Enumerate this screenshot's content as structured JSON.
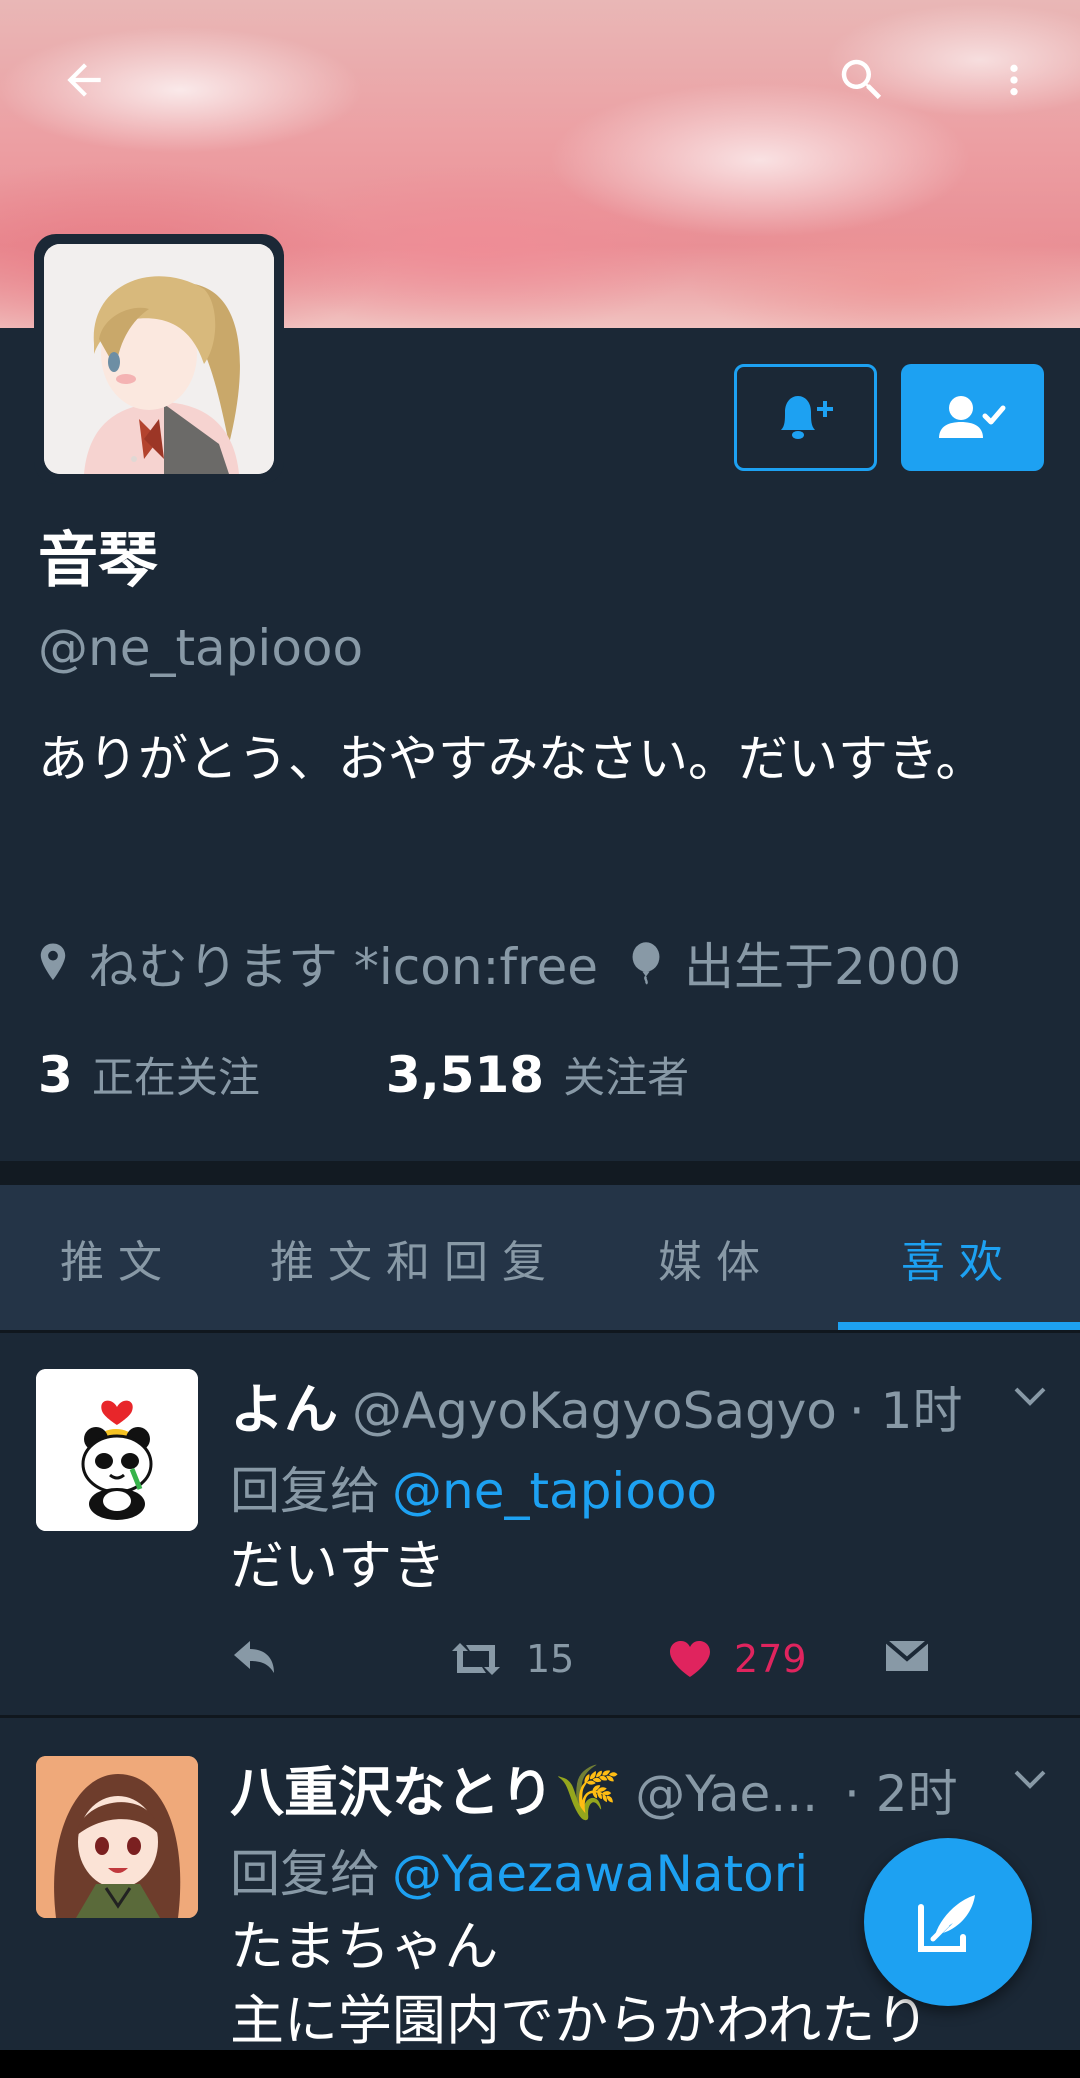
{
  "header": {
    "back_icon": "arrow-left-icon",
    "search_icon": "search-icon",
    "more_icon": "more-vertical-icon"
  },
  "profile": {
    "name": "音琴",
    "handle": "@ne_tapiooo",
    "bio": "ありがとう、おやすみなさい。だいすき。",
    "location": "ねむります *icon:free",
    "birth": "出生于2000",
    "following_count": "3",
    "following_label": "正在关注",
    "followers_count": "3,518",
    "followers_label": "关注者"
  },
  "buttons": {
    "notify_icon": "bell-plus-icon",
    "following_icon": "user-check-icon"
  },
  "tabs": [
    {
      "label": "推文",
      "active": false
    },
    {
      "label": "推文和回复",
      "active": false
    },
    {
      "label": "媒体",
      "active": false
    },
    {
      "label": "喜欢",
      "active": true
    }
  ],
  "tweets": [
    {
      "name": "よん",
      "handle": "@AgyoKagyoSagyo",
      "time": "· 1时",
      "reply_prefix": "回复给",
      "reply_to": "@ne_tapiooo",
      "text": "だいすき",
      "retweets": "15",
      "likes": "279",
      "liked": true
    },
    {
      "name": "八重沢なとり🌾",
      "handle": "@Yae...",
      "time": "· 2时",
      "reply_prefix": "回复给",
      "reply_to": "@YaezawaNatori",
      "text": "たまちゃん",
      "text2": "主に学園内でからかわれたり"
    }
  ],
  "fab": {
    "icon": "compose-icon"
  },
  "colors": {
    "background": "#1b2836",
    "accent": "#1da1f2",
    "like": "#e0245e",
    "muted": "#8899a6"
  }
}
